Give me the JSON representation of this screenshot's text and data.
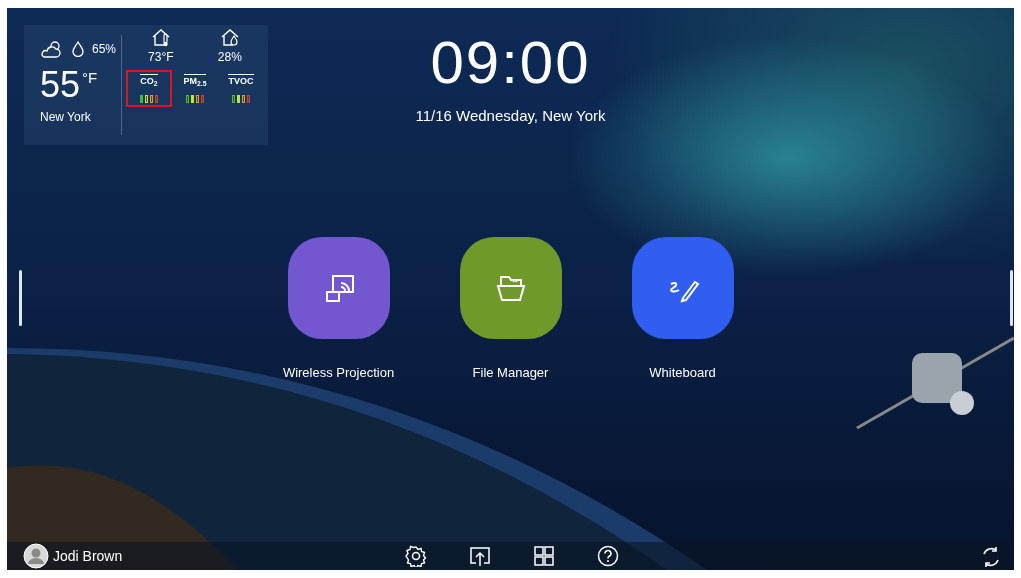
{
  "weather": {
    "humidity": "65%",
    "temperature": "55",
    "unit": "°F",
    "city": "New York"
  },
  "indoor": [
    {
      "kind": "temperature",
      "reading": "73°F"
    },
    {
      "kind": "humidity",
      "reading": "28%"
    }
  ],
  "sensors": [
    {
      "label": "CO$_{2}$",
      "highlighted": true,
      "segments": [
        {
          "color": "#3fbf3a",
          "on": true
        },
        {
          "color": "#c8e23a",
          "on": false
        },
        {
          "color": "#e0a020",
          "on": false
        },
        {
          "color": "#d04030",
          "on": false
        }
      ]
    },
    {
      "label": "PM$_{2.5}$",
      "highlighted": false,
      "segments": [
        {
          "color": "#3fbf3a",
          "on": false
        },
        {
          "color": "#c8e23a",
          "on": true
        },
        {
          "color": "#e0a020",
          "on": false
        },
        {
          "color": "#d04030",
          "on": false
        }
      ]
    },
    {
      "label": "TVOC",
      "highlighted": false,
      "segments": [
        {
          "color": "#3fbf3a",
          "on": false
        },
        {
          "color": "#c8e23a",
          "on": true
        },
        {
          "color": "#e0a020",
          "on": false
        },
        {
          "color": "#d04030",
          "on": false
        }
      ]
    }
  ],
  "clock": {
    "time": "09:00",
    "date": "11/16 Wednesday, New York"
  },
  "apps": [
    {
      "kind": "projection",
      "label": "Wireless Projection",
      "color": "#7257d0"
    },
    {
      "kind": "files",
      "label": "File Manager",
      "color": "#6f9a2a"
    },
    {
      "kind": "whiteboard",
      "label": "Whiteboard",
      "color": "#2f5ef0"
    }
  ],
  "user": {
    "name": "Jodi Brown"
  },
  "toolbar": [
    {
      "kind": "settings"
    },
    {
      "kind": "share"
    },
    {
      "kind": "apps"
    },
    {
      "kind": "help"
    }
  ]
}
